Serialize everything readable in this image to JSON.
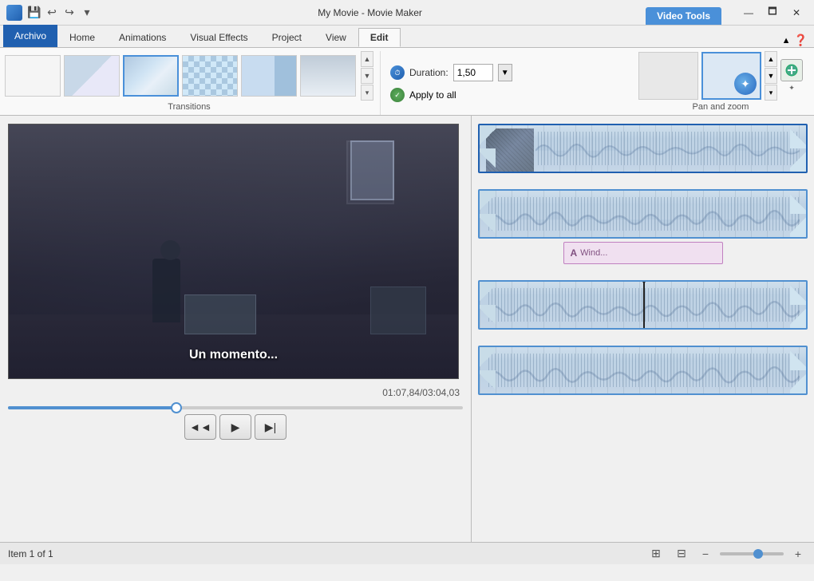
{
  "titleBar": {
    "appName": "My Movie - Movie Maker",
    "videoToolsLabel": "Video Tools",
    "quickAccess": [
      "💾",
      "↩",
      "↪"
    ],
    "windowControls": [
      "—",
      "🗖",
      "✕"
    ]
  },
  "tabs": [
    {
      "id": "archivo",
      "label": "Archivo",
      "active": false,
      "archivo": true
    },
    {
      "id": "home",
      "label": "Home",
      "active": false
    },
    {
      "id": "animations",
      "label": "Animations",
      "active": false
    },
    {
      "id": "visual-effects",
      "label": "Visual Effects",
      "active": false
    },
    {
      "id": "project",
      "label": "Project",
      "active": false
    },
    {
      "id": "view",
      "label": "View",
      "active": false
    },
    {
      "id": "edit",
      "label": "Edit",
      "active": true
    }
  ],
  "ribbon": {
    "transitions": {
      "label": "Transitions",
      "duration": {
        "label": "Duration:",
        "value": "1,50"
      },
      "applyToAll": "Apply to all"
    },
    "panZoom": {
      "label": "Pan and zoom"
    }
  },
  "preview": {
    "subtitle": "Un momento...",
    "timecode": "01:07,84/03:04,03",
    "progressPercent": 37
  },
  "playback": {
    "rewindLabel": "◄◄",
    "playLabel": "▶",
    "forwardLabel": "▶|"
  },
  "timeline": {
    "clips": [
      {
        "id": 1,
        "hasThumb": true,
        "active": true
      },
      {
        "id": 2,
        "hasThumb": false,
        "hasText": true,
        "textLabel": "A Wind..."
      },
      {
        "id": 3,
        "hasThumb": false,
        "active": false,
        "hasPlayhead": true
      },
      {
        "id": 4,
        "hasThumb": false,
        "active": false
      }
    ]
  },
  "statusBar": {
    "itemLabel": "Item 1 of 1"
  }
}
